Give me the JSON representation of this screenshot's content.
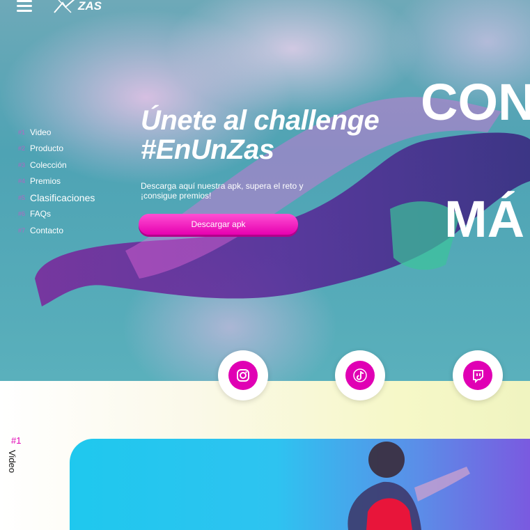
{
  "header": {
    "menu_icon": "hamburger-icon",
    "logo_icon": "star-burst-icon",
    "logo_text": "ZAS"
  },
  "sidenav": {
    "items": [
      {
        "num": "#1",
        "label": "Video"
      },
      {
        "num": "#2",
        "label": "Producto"
      },
      {
        "num": "#3",
        "label": "Colección"
      },
      {
        "num": "#4",
        "label": "Premios"
      },
      {
        "num": "#5",
        "label": "Clasificaciones"
      },
      {
        "num": "#6",
        "label": "FAQs"
      },
      {
        "num": "#7",
        "label": "Contacto"
      }
    ]
  },
  "hero": {
    "title_line1": "Únete al challenge",
    "title_line2": "#EnUnZas",
    "subtitle": "Descarga aquí nuestra apk, supera el reto y ¡consigue premios!",
    "cta_label": "Descargar apk",
    "big_text_1": "CON",
    "big_text_2": "MÁ"
  },
  "social": [
    {
      "icon": "instagram-icon"
    },
    {
      "icon": "tiktok-icon"
    },
    {
      "icon": "twitch-icon"
    }
  ],
  "section": {
    "number": "#1",
    "label": "Video"
  },
  "colors": {
    "accent": "#e000b4",
    "sky": "#4ea3b4",
    "band": "#f4f7c8",
    "video_bg": "#1fc8ee"
  }
}
